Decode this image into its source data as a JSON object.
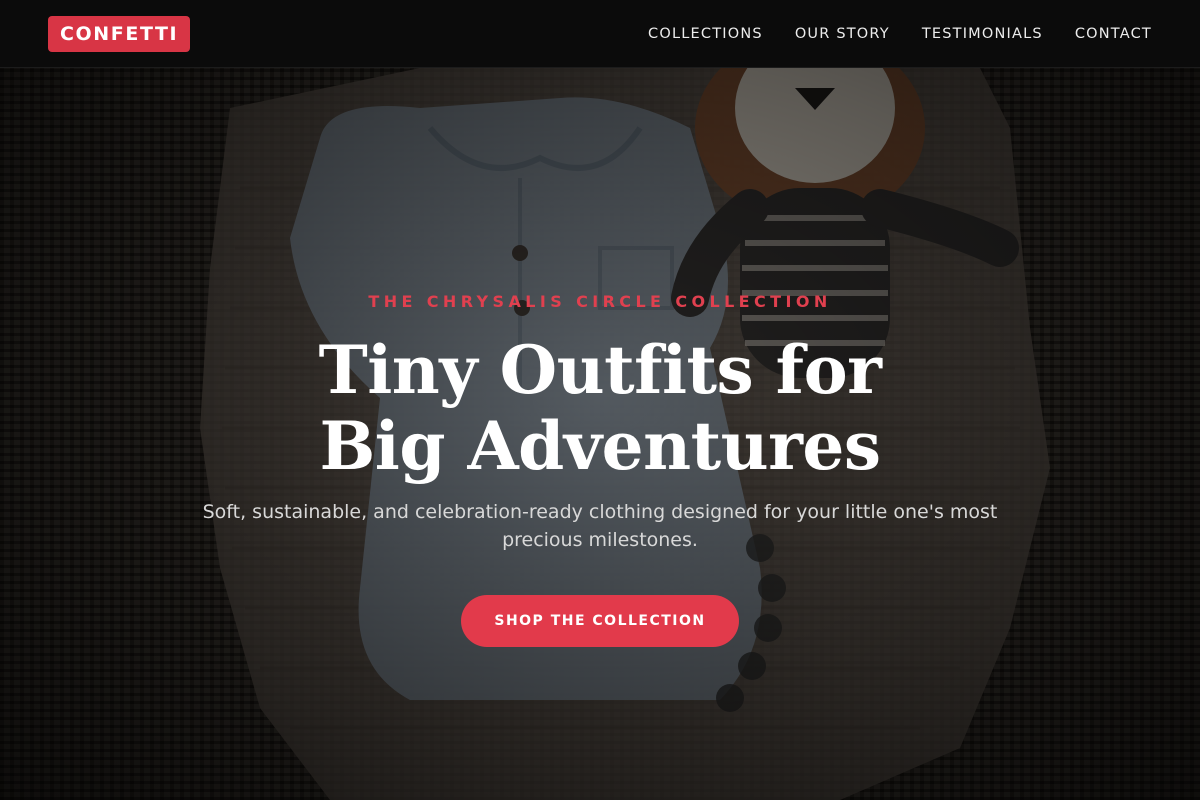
{
  "brand": {
    "logo_text": "CONFETTI",
    "accent_color": "#d83545"
  },
  "nav": {
    "items": [
      {
        "label": "COLLECTIONS"
      },
      {
        "label": "OUR STORY"
      },
      {
        "label": "TESTIMONIALS"
      },
      {
        "label": "CONTACT"
      }
    ]
  },
  "hero": {
    "eyebrow": "THE CHRYSALIS CIRCLE COLLECTION",
    "headline_line1": "Tiny Outfits for",
    "headline_line2": "Big Adventures",
    "subtitle": "Soft, sustainable, and celebration-ready clothing designed for your little one's most precious milestones.",
    "cta_label": "SHOP THE COLLECTION",
    "background_image": {
      "content": "flat-lay of baby romper, muslin blanket and stuffed lion toy on woven jute rug"
    }
  },
  "colors": {
    "topbar_bg": "#0b0b0b",
    "eyebrow": "#e0404f",
    "cta_bg": "#e23a4b",
    "headline": "#ffffff"
  }
}
